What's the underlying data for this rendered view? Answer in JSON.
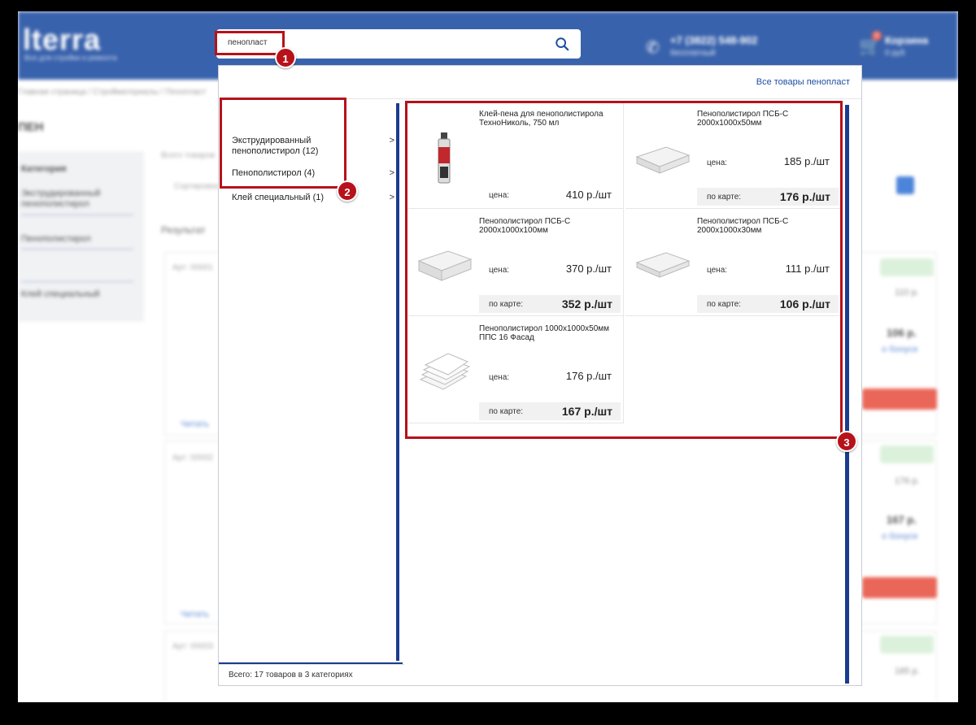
{
  "background_page": {
    "logo": "lterra",
    "logo_tagline": "Все для стройки и ремонта",
    "phone": "+7 (3822) 548-902",
    "phone_sub": "бесплатный",
    "cart_label": "Корзина",
    "cart_sub": "0 руб",
    "cart_count": "0",
    "breadcrumbs": "Главная страница / Стройматериалы / Пенопласт",
    "page_heading": "ПЕН",
    "filters": [
      "Категория",
      "Экструдированный пенополистирол",
      "Пенополистирол",
      "Клей специальный"
    ],
    "mid_labels": [
      "Всего товаров",
      "Сортировка",
      "Результат"
    ],
    "rows": [
      {
        "article": "Арт: 00001",
        "status": "В наличии",
        "unit_price": "110 р.",
        "card_price": "106 р.",
        "link": "о бонусе",
        "button": "В корзину"
      },
      {
        "article": "Арт: 00002",
        "status": "В наличии",
        "unit_price": "176 р.",
        "card_price": "167 р.",
        "link": "о бонусе",
        "button": "В корзину"
      },
      {
        "article": "Арт: 00003",
        "status": "В наличии",
        "unit_price": "185 р."
      }
    ],
    "left_link": "Читать"
  },
  "search": {
    "value": "пенопласт",
    "icon": "search-icon"
  },
  "annotations": {
    "badge_1": "1",
    "badge_2": "2",
    "badge_3": "3",
    "color": "#b7111a"
  },
  "dropdown": {
    "all_products_link": "Все товары пенопласт",
    "categories": [
      {
        "label": "Экструдированный пенополистирол (12)",
        "chevron": ">"
      },
      {
        "label": "Пенополистирол (4)",
        "chevron": ">"
      },
      {
        "label": "Клей специальный (1)",
        "chevron": ">"
      }
    ],
    "total": "Всего: 17 товаров в 3 категориях",
    "price_label": "цена:",
    "card_label": "по карте:",
    "products": [
      {
        "name": "Клей-пена для пенополистирола ТехноНиколь, 750 мл",
        "price": "410 р./шт",
        "card_price": "",
        "image": "glue-can"
      },
      {
        "name": "Пенополистирол ПСБ-С 2000x1000x50мм",
        "price": "185 р./шт",
        "card_price": "176 р./шт",
        "image": "foam-sheet"
      },
      {
        "name": "Пенополистирол ПСБ-С 2000x1000x100мм",
        "price": "370 р./шт",
        "card_price": "352 р./шт",
        "image": "foam-sheet"
      },
      {
        "name": "Пенополистирол ПСБ-С 2000x1000x30мм",
        "price": "111 р./шт",
        "card_price": "106 р./шт",
        "image": "foam-sheet"
      },
      {
        "name": "Пенополистирол 1000x1000x50мм ППС 16 Фасад",
        "price": "176 р./шт",
        "card_price": "167 р./шт",
        "image": "foam-stack"
      }
    ]
  }
}
